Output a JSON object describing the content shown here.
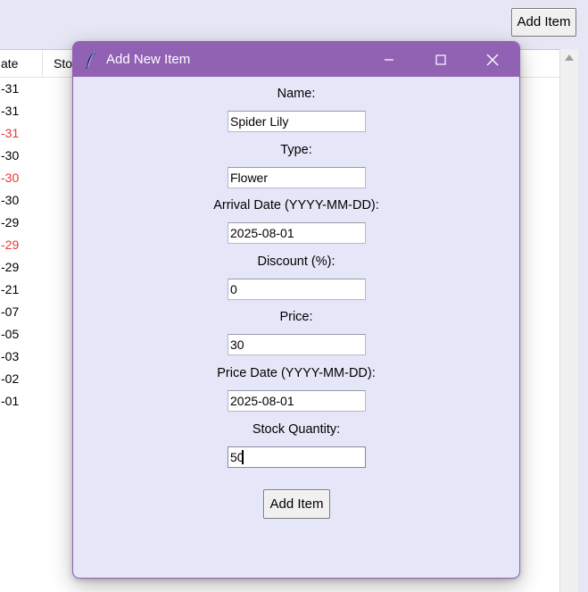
{
  "main_window": {
    "add_item_label": "Add Item",
    "table": {
      "columns": [
        "ate",
        "Sto"
      ],
      "rows": [
        {
          "date": "-31",
          "red": false
        },
        {
          "date": "-31",
          "red": false
        },
        {
          "date": "-31",
          "red": true
        },
        {
          "date": "-30",
          "red": false
        },
        {
          "date": "-30",
          "red": true
        },
        {
          "date": "-30",
          "red": false
        },
        {
          "date": "-29",
          "red": false
        },
        {
          "date": "-29",
          "red": true
        },
        {
          "date": "-29",
          "red": false
        },
        {
          "date": "-21",
          "red": false
        },
        {
          "date": "-07",
          "red": false
        },
        {
          "date": "-05",
          "red": false
        },
        {
          "date": "-03",
          "red": false
        },
        {
          "date": "-02",
          "red": false
        },
        {
          "date": "-01",
          "red": false
        }
      ]
    }
  },
  "dialog": {
    "title": "Add New Item",
    "icon": "feather-icon",
    "fields": [
      {
        "name": "name",
        "label": "Name:",
        "value": "Spider Lily"
      },
      {
        "name": "type",
        "label": "Type:",
        "value": "Flower"
      },
      {
        "name": "arrival-date",
        "label": "Arrival Date (YYYY-MM-DD):",
        "value": "2025-08-01"
      },
      {
        "name": "discount",
        "label": "Discount (%):",
        "value": "0"
      },
      {
        "name": "price",
        "label": "Price:",
        "value": "30"
      },
      {
        "name": "price-date",
        "label": "Price Date (YYYY-MM-DD):",
        "value": "2025-08-01"
      },
      {
        "name": "stock-quantity",
        "label": "Stock Quantity:",
        "value": "50"
      }
    ],
    "submit_label": "Add Item"
  },
  "colors": {
    "titlebar": "#9161b4",
    "dialog_background": "#e6e6f9",
    "window_background": "#e6e6f5",
    "red_text": "#e53935"
  }
}
